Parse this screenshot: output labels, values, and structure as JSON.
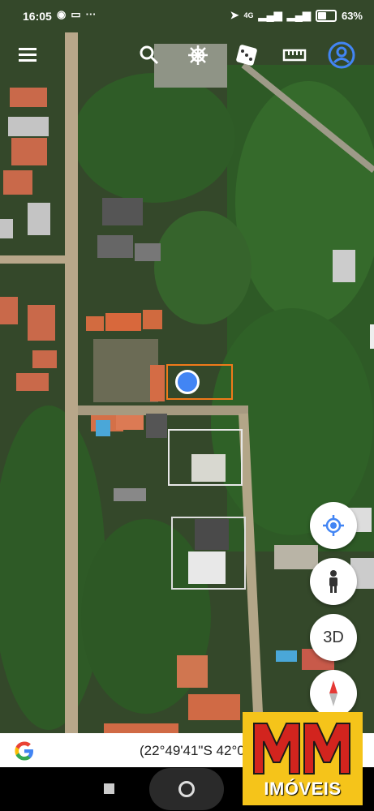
{
  "status_bar": {
    "time": "16:05",
    "network": "4G",
    "battery": "63%",
    "battery_level": 0.63
  },
  "top_toolbar": {
    "icons": [
      "menu-icon",
      "search-icon",
      "ship-wheel-icon",
      "dice-icon",
      "ruler-icon",
      "account-icon"
    ]
  },
  "map": {
    "type": "satellite",
    "location_marker": "blue dot inside orange rectangle"
  },
  "controls": {
    "my_location_icon": "my-location-icon",
    "street_view_icon": "pegman-icon",
    "three_d_label": "3D",
    "compass_icon": "compass-icon"
  },
  "search_bar": {
    "coordinates": "(22°49'41\"S 42°0"
  },
  "logo": {
    "brand_text": "IMÓVEIS",
    "mark": "MM"
  },
  "colors": {
    "accent_blue": "#4285f4",
    "selection_orange": "#f07a1a",
    "logo_yellow": "#f5c41a",
    "logo_red": "#d2241e"
  }
}
